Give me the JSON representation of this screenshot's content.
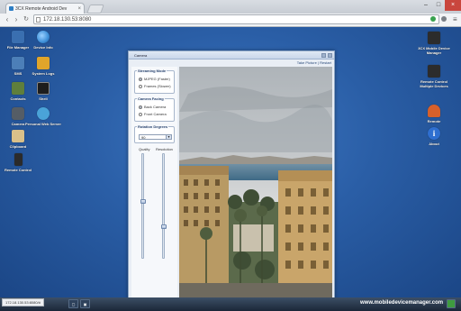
{
  "browser": {
    "tab_title": "3CX Remote Android Dev",
    "tab_close": "×",
    "url": "172.18.130.53:8080",
    "window_controls": {
      "minimize": "–",
      "maximize": "□",
      "close": "×"
    },
    "nav": {
      "back": "‹",
      "forward": "›",
      "reload": "↻"
    },
    "menu_glyph": "≡"
  },
  "desktop_icons_left": [
    {
      "label": "File Manager",
      "icon": "folder-icon",
      "color": "#3a6fb0"
    },
    {
      "label": "Device Info",
      "icon": "globe-icon",
      "color": "#3d8fd8"
    },
    {
      "label": "SMS",
      "icon": "sms-icon",
      "color": "#4c7fb8"
    },
    {
      "label": "System Logs",
      "icon": "logs-icon",
      "color": "#e0a52a"
    },
    {
      "label": "Contacts",
      "icon": "contacts-icon",
      "color": "#5f7f3c"
    },
    {
      "label": "Shell",
      "icon": "terminal-icon",
      "color": "#1d1d1d"
    },
    {
      "label": "Camera",
      "icon": "camera-icon",
      "color": "#555d66"
    },
    {
      "label": "Personal Web Server",
      "icon": "web-server-icon",
      "color": "#4aa3d8"
    },
    {
      "label": "Clipboard",
      "icon": "clipboard-icon",
      "color": "#d9c08a"
    },
    {
      "label": "Remote Control",
      "icon": "remote-control-icon",
      "color": "#2b2b2b"
    }
  ],
  "desktop_icons_right": [
    {
      "label": "3CX Mobile Device Manager",
      "icon": "3cx-logo-icon",
      "color": "#2c2c2c"
    },
    {
      "label": "Remote Control Multiple Devices",
      "icon": "3cx-logo-icon",
      "color": "#2c2c2c"
    },
    {
      "label": "Remote",
      "icon": "person-icon",
      "color": "#d6602b"
    },
    {
      "label": "About",
      "icon": "info-icon",
      "color": "#2f6fd0"
    }
  ],
  "camera_window": {
    "title": "Camera",
    "take_picture": "Take Picture",
    "separator": "|",
    "restart": "Restart",
    "streaming_mode": {
      "legend": "Streaming Mode",
      "options": [
        "MJPEG (Faster)",
        "Frames (Slower)"
      ],
      "selected": 0
    },
    "camera_facing": {
      "legend": "Camera Facing",
      "options": [
        "Back Camera",
        "Front Camera"
      ],
      "selected": 0
    },
    "rotation": {
      "legend": "Rotation Degrees",
      "value": "90"
    },
    "quality_label": "Quality",
    "resolution_label": "Resolution",
    "quality_level": 0.55,
    "resolution_level": 0.3
  },
  "statusbar": {
    "text": "172.18.130.53:8080/#"
  },
  "taskbar": {
    "brand": "www.mobiledevicemanager.com"
  },
  "colors": {
    "desktop": "#2a5ea6",
    "accent": "#2c4670"
  }
}
